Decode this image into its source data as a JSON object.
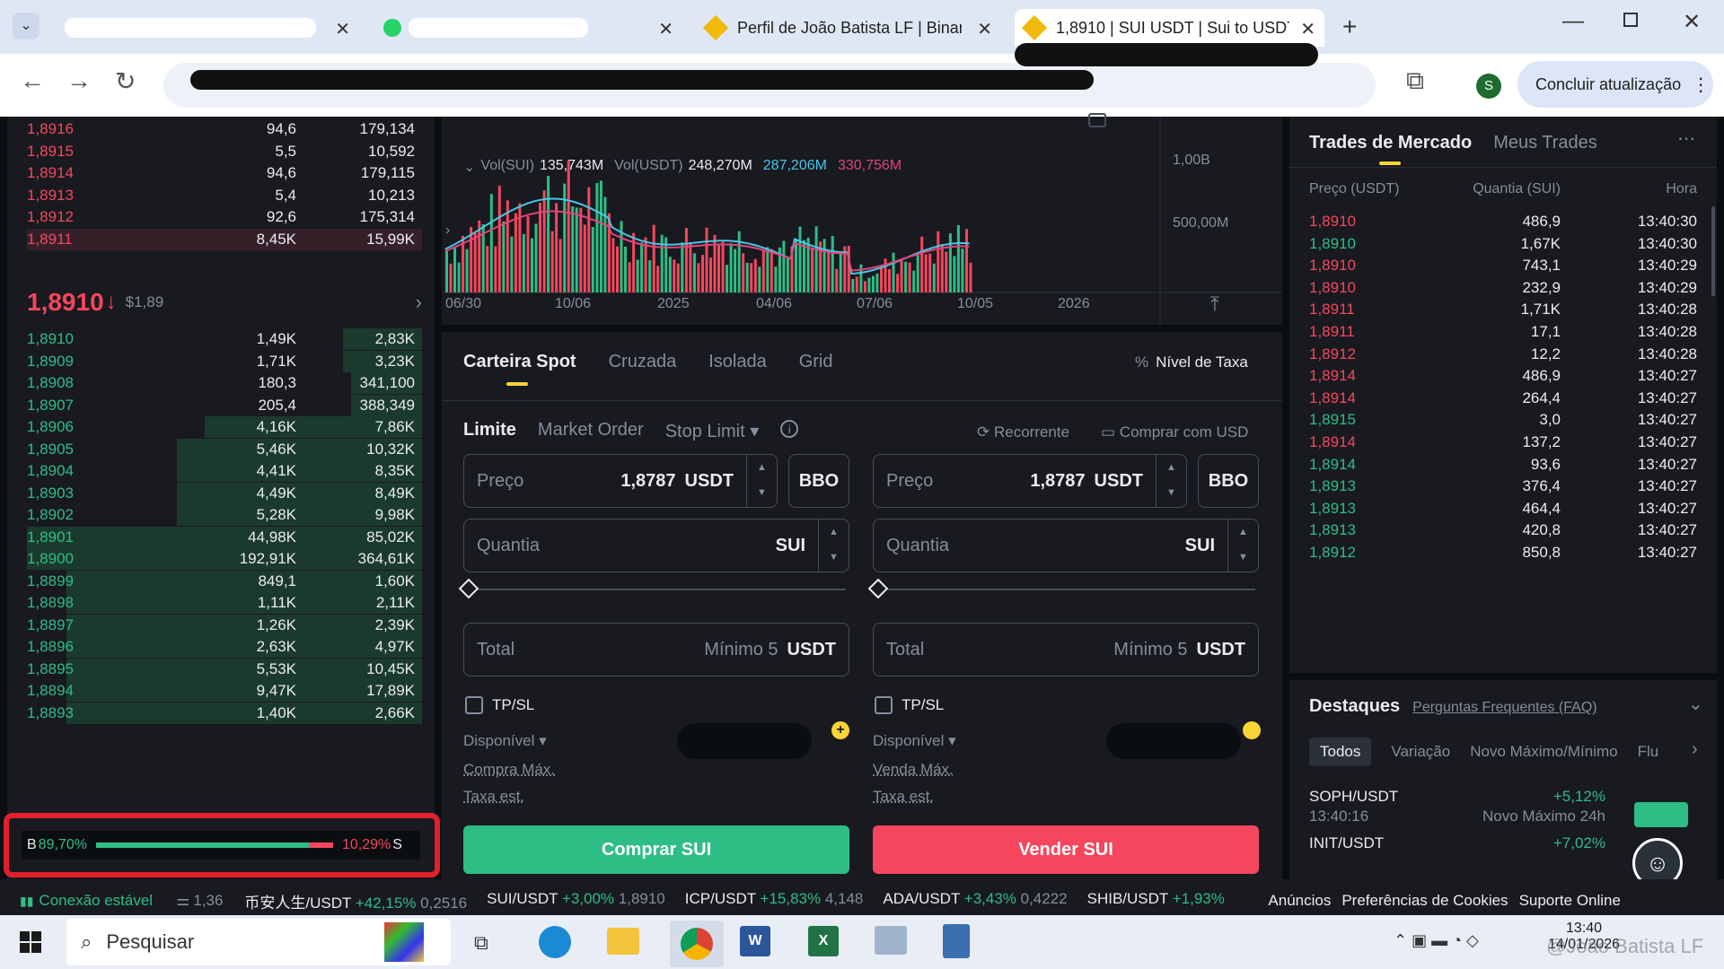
{
  "browser": {
    "tabs": [
      {
        "title": "",
        "redacted": true
      },
      {
        "title": "",
        "redacted": true
      },
      {
        "title": "Perfil de João Batista LF | Binanc"
      },
      {
        "title": "1,8910 | SUI USDT | Sui to USDT"
      }
    ],
    "profile_initial": "S",
    "update_label": "Concluir atualização"
  },
  "orderbook": {
    "asks": [
      {
        "price": "1,8916",
        "qty": "94,6",
        "total": "179,134"
      },
      {
        "price": "1,8915",
        "qty": "5,5",
        "total": "10,592"
      },
      {
        "price": "1,8914",
        "qty": "94,6",
        "total": "179,115"
      },
      {
        "price": "1,8913",
        "qty": "5,4",
        "total": "10,213"
      },
      {
        "price": "1,8912",
        "qty": "92,6",
        "total": "175,314"
      },
      {
        "price": "1,8911",
        "qty": "8,45K",
        "total": "15,99K"
      }
    ],
    "last_price": "1,8910",
    "last_arrow": "↓",
    "last_usd": "$1,89",
    "bids": [
      {
        "price": "1,8910",
        "qty": "1,49K",
        "total": "2,83K",
        "depth": 0.2
      },
      {
        "price": "1,8909",
        "qty": "1,71K",
        "total": "3,23K",
        "depth": 0.2
      },
      {
        "price": "1,8908",
        "qty": "180,3",
        "total": "341,100",
        "depth": 0.18
      },
      {
        "price": "1,8907",
        "qty": "205,4",
        "total": "388,349",
        "depth": 0.18
      },
      {
        "price": "1,8906",
        "qty": "4,16K",
        "total": "7,86K",
        "depth": 0.55
      },
      {
        "price": "1,8905",
        "qty": "5,46K",
        "total": "10,32K",
        "depth": 0.62
      },
      {
        "price": "1,8904",
        "qty": "4,41K",
        "total": "8,35K",
        "depth": 0.62
      },
      {
        "price": "1,8903",
        "qty": "4,49K",
        "total": "8,49K",
        "depth": 0.62
      },
      {
        "price": "1,8902",
        "qty": "5,28K",
        "total": "9,98K",
        "depth": 0.62
      },
      {
        "price": "1,8901",
        "qty": "44,98K",
        "total": "85,02K",
        "depth": 1.0
      },
      {
        "price": "1,8900",
        "qty": "192,91K",
        "total": "364,61K",
        "depth": 1.0
      },
      {
        "price": "1,8899",
        "qty": "849,1",
        "total": "1,60K",
        "depth": 0.9
      },
      {
        "price": "1,8898",
        "qty": "1,11K",
        "total": "2,11K",
        "depth": 0.9
      },
      {
        "price": "1,8897",
        "qty": "1,26K",
        "total": "2,39K",
        "depth": 0.9
      },
      {
        "price": "1,8896",
        "qty": "2,63K",
        "total": "4,97K",
        "depth": 0.9
      },
      {
        "price": "1,8895",
        "qty": "5,53K",
        "total": "10,45K",
        "depth": 0.9
      },
      {
        "price": "1,8894",
        "qty": "9,47K",
        "total": "17,89K",
        "depth": 0.9
      },
      {
        "price": "1,8893",
        "qty": "1,40K",
        "total": "2,66K",
        "depth": 0.9
      }
    ],
    "ratio_buy_label": "B",
    "ratio_buy": "89,70%",
    "ratio_sell": "10,29%",
    "ratio_sell_label": "S",
    "ratio_buy_fraction": 0.897
  },
  "volume_chart": {
    "vol_sui_label": "Vol(SUI)",
    "vol_sui": "135,743M",
    "vol_usdt_label": "Vol(USDT)",
    "vol_usdt": "248,270M",
    "ma1": "287,206M",
    "ma2": "330,756M",
    "y_ticks": [
      "1,00B",
      "500,00M"
    ],
    "x_ticks": [
      "06/30",
      "10/06",
      "2025",
      "04/06",
      "07/06",
      "10/05",
      "2026"
    ]
  },
  "order_form": {
    "tabs": [
      "Carteira Spot",
      "Cruzada",
      "Isolada",
      "Grid"
    ],
    "fee_label": "Nível de Taxa",
    "types": [
      "Limite",
      "Market Order",
      "Stop Limit"
    ],
    "recurring": "Recorrente",
    "buy_with": "Comprar com USD",
    "price_label": "Preço",
    "price_value": "1,8787",
    "quote": "USDT",
    "bbo": "BBO",
    "qty_label": "Quantia",
    "base": "SUI",
    "total_label": "Total",
    "min_label": "Mínimo 5",
    "tpsl": "TP/SL",
    "available": "Disponível",
    "buy_max": "Compra Máx.",
    "sell_max": "Venda Máx.",
    "fee_est": "Taxa est.",
    "buy_button": "Comprar SUI",
    "sell_button": "Vender SUI"
  },
  "trades": {
    "tabs": [
      "Trades de Mercado",
      "Meus Trades"
    ],
    "headers": [
      "Preço (USDT)",
      "Quantia (SUI)",
      "Hora"
    ],
    "rows": [
      {
        "price": "1,8910",
        "qty": "486,9",
        "time": "13:40:30",
        "side": "sell"
      },
      {
        "price": "1,8910",
        "qty": "1,67K",
        "time": "13:40:30",
        "side": "buy"
      },
      {
        "price": "1,8910",
        "qty": "743,1",
        "time": "13:40:29",
        "side": "sell"
      },
      {
        "price": "1,8910",
        "qty": "232,9",
        "time": "13:40:29",
        "side": "sell"
      },
      {
        "price": "1,8911",
        "qty": "1,71K",
        "time": "13:40:28",
        "side": "sell"
      },
      {
        "price": "1,8911",
        "qty": "17,1",
        "time": "13:40:28",
        "side": "sell"
      },
      {
        "price": "1,8912",
        "qty": "12,2",
        "time": "13:40:28",
        "side": "sell"
      },
      {
        "price": "1,8914",
        "qty": "486,9",
        "time": "13:40:27",
        "side": "sell"
      },
      {
        "price": "1,8914",
        "qty": "264,4",
        "time": "13:40:27",
        "side": "sell"
      },
      {
        "price": "1,8915",
        "qty": "3,0",
        "time": "13:40:27",
        "side": "buy"
      },
      {
        "price": "1,8914",
        "qty": "137,2",
        "time": "13:40:27",
        "side": "sell"
      },
      {
        "price": "1,8914",
        "qty": "93,6",
        "time": "13:40:27",
        "side": "buy"
      },
      {
        "price": "1,8913",
        "qty": "376,4",
        "time": "13:40:27",
        "side": "buy"
      },
      {
        "price": "1,8913",
        "qty": "464,4",
        "time": "13:40:27",
        "side": "buy"
      },
      {
        "price": "1,8913",
        "qty": "420,8",
        "time": "13:40:27",
        "side": "buy"
      },
      {
        "price": "1,8912",
        "qty": "850,8",
        "time": "13:40:27",
        "side": "buy"
      }
    ]
  },
  "highlights": {
    "title": "Destaques",
    "faq": "Perguntas Frequentes (FAQ)",
    "filters": [
      "Todos",
      "Variação",
      "Novo Máximo/Mínimo",
      "Flu"
    ],
    "items": [
      {
        "pair": "SOPH/USDT",
        "time": "13:40:16",
        "change": "+5,12%",
        "note": "Novo Máximo 24h"
      },
      {
        "pair": "INIT/USDT",
        "change": "+7,02%"
      }
    ]
  },
  "status_bar": {
    "connection": "Conexão estável",
    "partial": "1,36",
    "tickers": [
      {
        "pair": "币安人生/USDT",
        "change": "+42,15%",
        "price": "0,2516"
      },
      {
        "pair": "SUI/USDT",
        "change": "+3,00%",
        "price": "1,8910"
      },
      {
        "pair": "ICP/USDT",
        "change": "+15,83%",
        "price": "4,148"
      },
      {
        "pair": "ADA/USDT",
        "change": "+3,43%",
        "price": "0,4222"
      },
      {
        "pair": "SHIB/USDT",
        "change": "+1,93%",
        "price": ""
      }
    ],
    "links": [
      "Anúncios",
      "Preferências de Cookies",
      "Suporte Online"
    ]
  },
  "taskbar": {
    "search": "Pesquisar",
    "time": "13:40",
    "date": "14/01/2026",
    "watermark": "@João Batista LF"
  },
  "colors": {
    "up": "#2ebd85",
    "down": "#f6465d",
    "accent": "#fcd535",
    "bg": "#181a20"
  }
}
